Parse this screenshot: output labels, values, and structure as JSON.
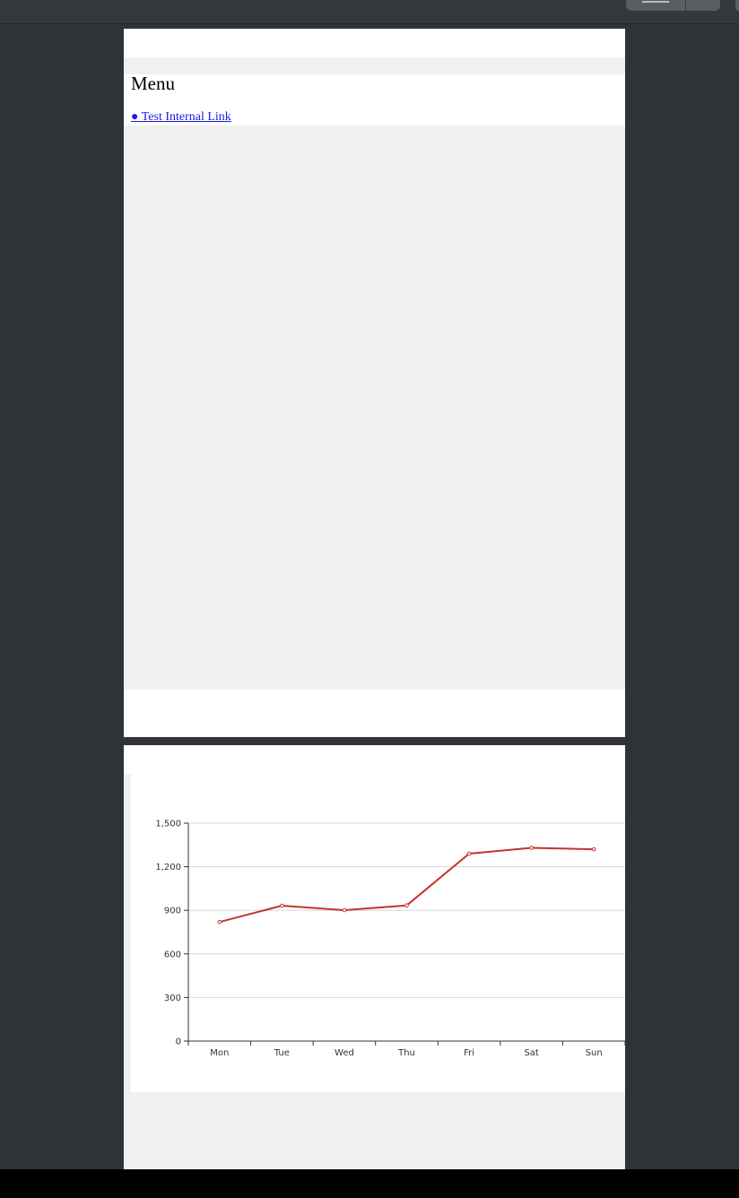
{
  "menu": {
    "title": "Menu",
    "link": "● Test Internal Link"
  },
  "chart_data": {
    "type": "line",
    "categories": [
      "Mon",
      "Tue",
      "Wed",
      "Thu",
      "Fri",
      "Sat",
      "Sun"
    ],
    "series": [
      {
        "values": [
          820,
          932,
          901,
          934,
          1290,
          1330,
          1320
        ]
      }
    ],
    "y_ticks": [
      "0",
      "300",
      "600",
      "900",
      "1,200",
      "1,500"
    ],
    "ylim": [
      0,
      1500
    ],
    "grid": true,
    "line_color": "#c23531"
  }
}
